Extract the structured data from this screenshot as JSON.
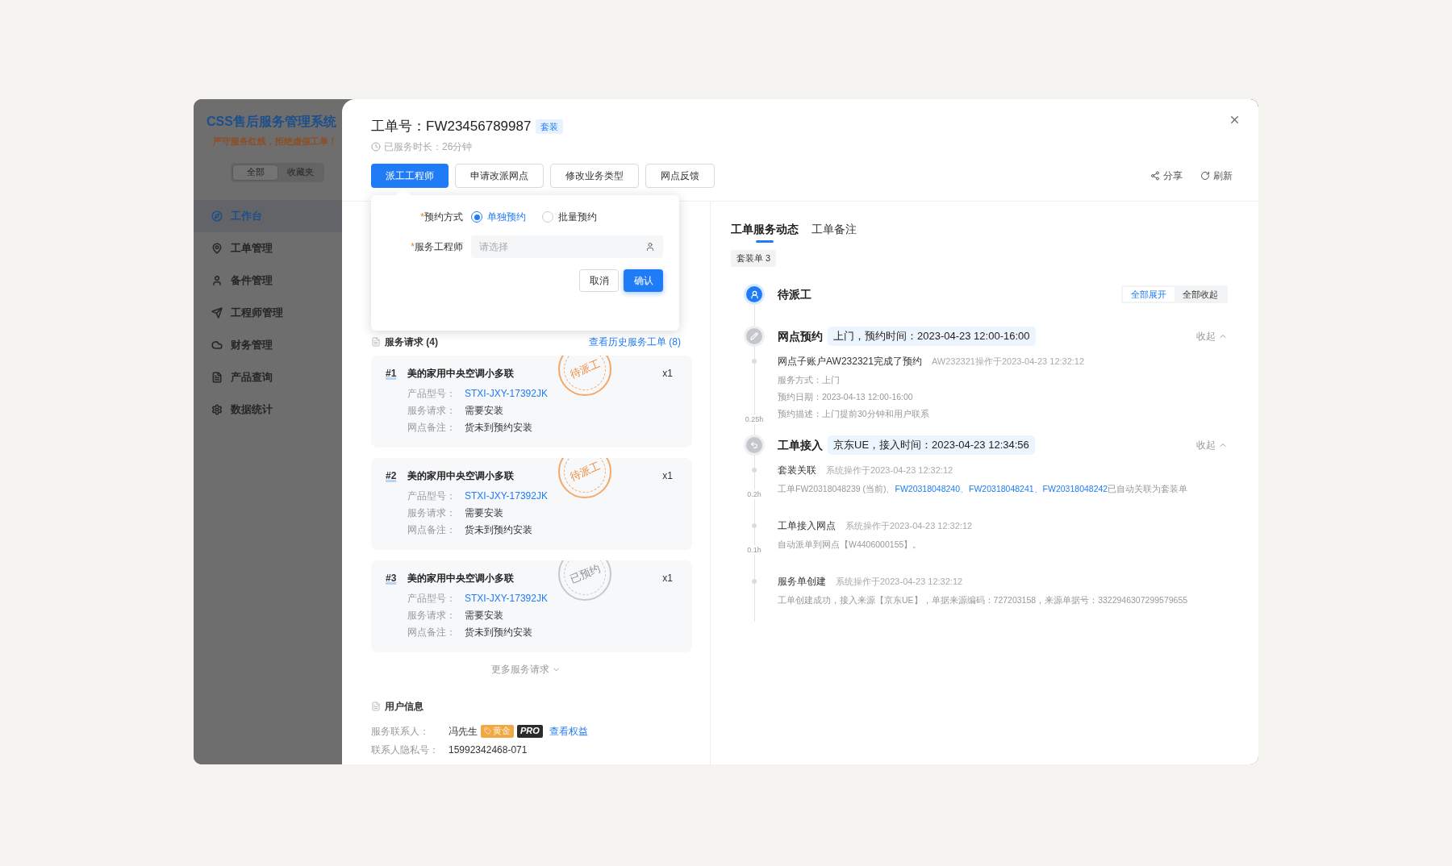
{
  "sidebar": {
    "title": "CSS售后服务管理系统",
    "slogan": "严守服务红线，拒绝虚假工单！",
    "filters": [
      {
        "label": "全部",
        "selected": true
      },
      {
        "label": "收藏夹",
        "selected": false
      }
    ],
    "items": [
      {
        "label": "工作台",
        "selected": true
      },
      {
        "label": "工单管理",
        "selected": false
      },
      {
        "label": "备件管理",
        "selected": false
      },
      {
        "label": "工程师管理",
        "selected": false
      },
      {
        "label": "财务管理",
        "selected": false
      },
      {
        "label": "产品查询",
        "selected": false
      },
      {
        "label": "数据统计",
        "selected": false
      }
    ]
  },
  "order": {
    "title_label": "工单号：",
    "number": "FW23456789987",
    "tag": "套装",
    "duration": "已服务时长：26分钟",
    "actions": [
      {
        "label": "派工工程师",
        "selected": true
      },
      {
        "label": "申请改派网点",
        "selected": false
      },
      {
        "label": "修改业务类型",
        "selected": false
      },
      {
        "label": "网点反馈",
        "selected": false
      }
    ],
    "tools": [
      "分享",
      "刷新"
    ]
  },
  "dispatch_popover": {
    "fields": [
      {
        "kind": "radio",
        "required_mark": "*",
        "label": "预约方式",
        "options": [
          {
            "label": "单独预约",
            "selected": true
          },
          {
            "label": "批量预约",
            "selected": false
          }
        ]
      },
      {
        "kind": "select",
        "required_mark": "*",
        "label": "服务工程师",
        "placeholder": "请选择"
      }
    ],
    "buttons": [
      {
        "label": "取消",
        "kind": "secondary"
      },
      {
        "label": "确认",
        "kind": "primary"
      }
    ]
  },
  "service_requests": {
    "title": "服务请求 (4)",
    "history_link": "查看历史服务工单 (8)",
    "items": [
      {
        "index": "#1",
        "name": "美的家用中央空调小多联",
        "quantity": "x1",
        "stamp": {
          "text": "待派工",
          "kind": "pending"
        },
        "fields": [
          {
            "label": "产品型号：",
            "value": "STXI-JXY-17392JK",
            "kind": "link"
          },
          {
            "label": "服务请求：",
            "value": "需要安装",
            "kind": "text"
          },
          {
            "label": "网点备注：",
            "value": "货未到预约安装",
            "kind": "text"
          }
        ]
      },
      {
        "index": "#2",
        "name": "美的家用中央空调小多联",
        "quantity": "x1",
        "stamp": {
          "text": "待派工",
          "kind": "pending"
        },
        "fields": [
          {
            "label": "产品型号：",
            "value": "STXI-JXY-17392JK",
            "kind": "link"
          },
          {
            "label": "服务请求：",
            "value": "需要安装",
            "kind": "text"
          },
          {
            "label": "网点备注：",
            "value": "货未到预约安装",
            "kind": "text"
          }
        ]
      },
      {
        "index": "#3",
        "name": "美的家用中央空调小多联",
        "quantity": "x1",
        "stamp": {
          "text": "已预约",
          "kind": "booked"
        },
        "fields": [
          {
            "label": "产品型号：",
            "value": "STXI-JXY-17392JK",
            "kind": "link"
          },
          {
            "label": "服务请求：",
            "value": "需要安装",
            "kind": "text"
          },
          {
            "label": "网点备注：",
            "value": "货未到预约安装",
            "kind": "text"
          }
        ]
      }
    ],
    "more": "更多服务请求"
  },
  "user_info": {
    "title": "用户信息",
    "rows": [
      {
        "label": "服务联系人：",
        "value": "冯先生",
        "badges": [
          {
            "text": "黄金",
            "kind": "gold"
          },
          {
            "text": "PRO",
            "kind": "pro"
          }
        ],
        "link": "查看权益"
      },
      {
        "label": "联系人隐私号：",
        "value": "15992342468-071"
      }
    ]
  },
  "activity": {
    "tabs": [
      {
        "label": "工单服务动态",
        "selected": true
      },
      {
        "label": "工单备注",
        "selected": false
      }
    ],
    "group_tag": "套装单 3",
    "status": {
      "title": "待派工",
      "kind": "pending"
    },
    "expand_controls": [
      {
        "label": "全部展开",
        "selected": true
      },
      {
        "label": "全部收起",
        "selected": false
      }
    ],
    "groups": [
      {
        "kind": "appointment",
        "title": "网点预约",
        "summary": "上门，预约时间：2023-04-23 12:00-16:00",
        "toggle": "收起",
        "expanded": true,
        "entries": [
          {
            "title": "网点子账户AW232321完成了预约",
            "meta": "AW232321操作于2023-04-23 12:32:12",
            "elapsed": "0.25h",
            "lines": [
              [
                {
                  "text": "服务方式：上门",
                  "link": false
                }
              ],
              [
                {
                  "text": "预约日期：2023-04-13 12:00-16:00",
                  "link": false
                }
              ],
              [
                {
                  "text": "预约描述：上门提前30分钟和用户联系",
                  "link": false
                }
              ]
            ]
          }
        ]
      },
      {
        "kind": "intake",
        "title": "工单接入",
        "summary": "京东UE，接入时间：2023-04-23 12:34:56",
        "toggle": "收起",
        "expanded": true,
        "entries": [
          {
            "title": "套装关联",
            "meta": "系统操作于2023-04-23 12:32:12",
            "elapsed": "0.2h",
            "lines": [
              [
                {
                  "text": "工单FW20318048239 (当前)、",
                  "link": false
                },
                {
                  "text": "FW20318048240",
                  "link": true
                },
                {
                  "text": "、",
                  "link": false
                },
                {
                  "text": "FW20318048241",
                  "link": true
                },
                {
                  "text": "、",
                  "link": false
                },
                {
                  "text": "FW20318048242",
                  "link": true
                },
                {
                  "text": "已自动关联为套装单",
                  "link": false
                }
              ]
            ]
          },
          {
            "title": "工单接入网点",
            "meta": "系统操作于2023-04-23 12:32:12",
            "elapsed": "0.1h",
            "lines": [
              [
                {
                  "text": "自动派单到网点【W4406000155】。",
                  "link": false
                }
              ]
            ]
          },
          {
            "title": "服务单创建",
            "meta": "系统操作于2023-04-23 12:32:12",
            "lines": [
              [
                {
                  "text": "工单创建成功，接入来源【京东UE】，单据来源编码：727203158，来源单据号：3322946307299579655",
                  "link": false
                }
              ]
            ]
          }
        ]
      }
    ]
  }
}
